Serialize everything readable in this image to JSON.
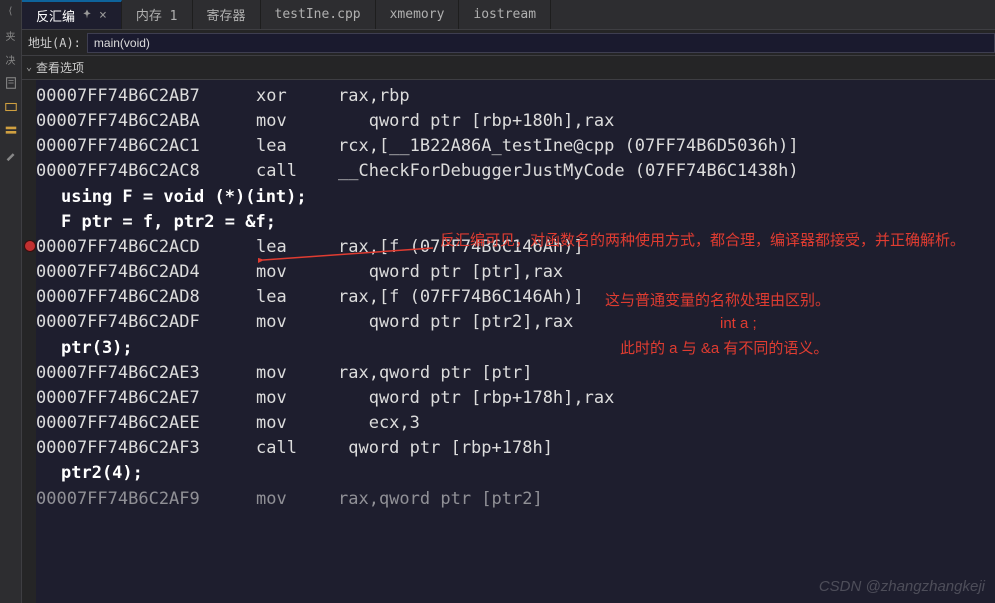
{
  "tabs": [
    {
      "label": "反汇编",
      "active": true,
      "closable": true,
      "pinned": true
    },
    {
      "label": "内存 1"
    },
    {
      "label": "寄存器"
    },
    {
      "label": "testIne.cpp"
    },
    {
      "label": "xmemory"
    },
    {
      "label": "iostream"
    }
  ],
  "toolbar": {
    "address_label": "地址(A):",
    "address_value": "main(void)"
  },
  "options": {
    "label": "查看选项"
  },
  "code": {
    "lines": [
      {
        "type": "asm",
        "addr": "00007FF74B6C2AB7",
        "opcode": "xor",
        "operand": "rax,rbp"
      },
      {
        "type": "asm",
        "addr": "00007FF74B6C2ABA",
        "opcode": "mov",
        "operand": "   qword ptr [rbp+180h],rax"
      },
      {
        "type": "asm",
        "addr": "00007FF74B6C2AC1",
        "opcode": "lea",
        "operand": "rcx,[__1B22A86A_testIne@cpp (07FF74B6D5036h)]"
      },
      {
        "type": "asm",
        "addr": "00007FF74B6C2AC8",
        "opcode": "call",
        "operand": "__CheckForDebuggerJustMyCode (07FF74B6C1438h)"
      },
      {
        "type": "src",
        "text": "using F = void (*)(int);"
      },
      {
        "type": "src",
        "text": "F ptr = f, ptr2 = &f;"
      },
      {
        "type": "asm",
        "addr": "00007FF74B6C2ACD",
        "opcode": "lea",
        "operand": "rax,[f (07FF74B6C146Ah)]",
        "breakpoint": true
      },
      {
        "type": "asm",
        "addr": "00007FF74B6C2AD4",
        "opcode": "mov",
        "operand": "   qword ptr [ptr],rax"
      },
      {
        "type": "asm",
        "addr": "00007FF74B6C2AD8",
        "opcode": "lea",
        "operand": "rax,[f (07FF74B6C146Ah)]"
      },
      {
        "type": "asm",
        "addr": "00007FF74B6C2ADF",
        "opcode": "mov",
        "operand": "   qword ptr [ptr2],rax"
      },
      {
        "type": "src2",
        "text": "ptr(3);"
      },
      {
        "type": "asm",
        "addr": "00007FF74B6C2AE3",
        "opcode": "mov",
        "operand": "rax,qword ptr [ptr]"
      },
      {
        "type": "asm",
        "addr": "00007FF74B6C2AE7",
        "opcode": "mov",
        "operand": "   qword ptr [rbp+178h],rax"
      },
      {
        "type": "asm",
        "addr": "00007FF74B6C2AEE",
        "opcode": "mov",
        "operand": "   ecx,3"
      },
      {
        "type": "asm",
        "addr": "00007FF74B6C2AF3",
        "opcode": "call",
        "operand": " qword ptr [rbp+178h]"
      },
      {
        "type": "src2",
        "text": "ptr2(4);"
      },
      {
        "type": "asm",
        "addr": "00007FF74B6C2AF9",
        "opcode": "mov",
        "operand": "rax,qword ptr [ptr2]",
        "clipped": true
      }
    ]
  },
  "annotations": {
    "a1": "反汇编可见，对函数名的两种使用方式，都合理，编译器都接受，并正确解析。",
    "a2": "这与普通变量的名称处理由区别。",
    "a3": "int  a ;",
    "a4": "此时的 a 与 &a 有不同的语义。"
  },
  "watermark": "CSDN @zhangzhangkeji"
}
